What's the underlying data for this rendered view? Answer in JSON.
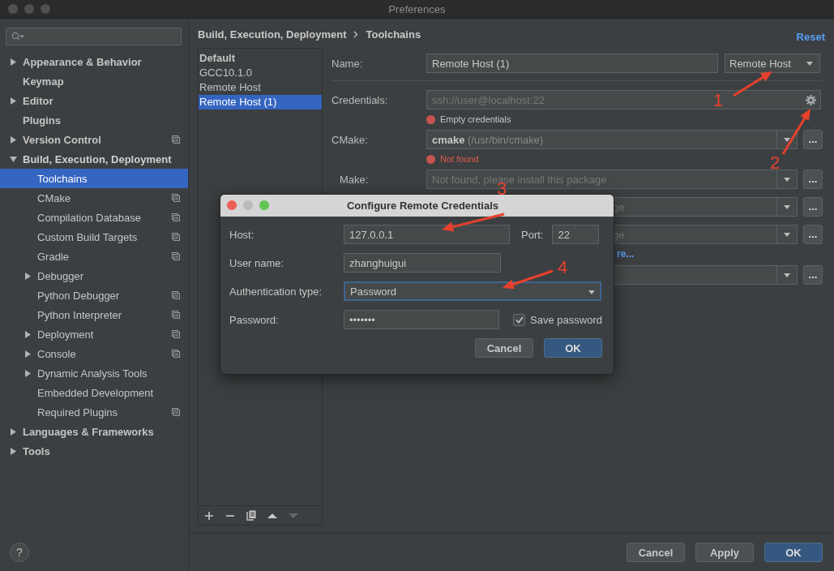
{
  "window": {
    "title": "Preferences"
  },
  "sidebar": {
    "items": [
      {
        "label": "Appearance & Behavior",
        "expandable": true,
        "expanded": false,
        "selected": false,
        "project_level": false
      },
      {
        "label": "Keymap",
        "expandable": false,
        "selected": false,
        "project_level": false
      },
      {
        "label": "Editor",
        "expandable": true,
        "expanded": false,
        "selected": false,
        "project_level": false
      },
      {
        "label": "Plugins",
        "expandable": false,
        "selected": false,
        "project_level": false
      },
      {
        "label": "Version Control",
        "expandable": true,
        "expanded": false,
        "selected": false,
        "project_level": true
      },
      {
        "label": "Build, Execution, Deployment",
        "expandable": true,
        "expanded": true,
        "selected": false,
        "project_level": false,
        "children": [
          {
            "label": "Toolchains",
            "expandable": false,
            "expanded": false,
            "selected": true,
            "project_level": false
          },
          {
            "label": "CMake",
            "expandable": false,
            "expanded": false,
            "selected": false,
            "project_level": true
          },
          {
            "label": "Compilation Database",
            "expandable": false,
            "expanded": false,
            "selected": false,
            "project_level": true
          },
          {
            "label": "Custom Build Targets",
            "expandable": false,
            "expanded": false,
            "selected": false,
            "project_level": true
          },
          {
            "label": "Gradle",
            "expandable": false,
            "expanded": false,
            "selected": false,
            "project_level": true
          },
          {
            "label": "Debugger",
            "expandable": true,
            "expanded": false,
            "selected": false,
            "project_level": false
          },
          {
            "label": "Python Debugger",
            "expandable": false,
            "expanded": false,
            "selected": false,
            "project_level": true
          },
          {
            "label": "Python Interpreter",
            "expandable": false,
            "expanded": false,
            "selected": false,
            "project_level": true
          },
          {
            "label": "Deployment",
            "expandable": true,
            "expanded": false,
            "selected": false,
            "project_level": true
          },
          {
            "label": "Console",
            "expandable": true,
            "expanded": false,
            "selected": false,
            "project_level": true
          },
          {
            "label": "Dynamic Analysis Tools",
            "expandable": true,
            "expanded": false,
            "selected": false,
            "project_level": false
          },
          {
            "label": "Embedded Development",
            "expandable": false,
            "expanded": false,
            "selected": false,
            "project_level": false
          },
          {
            "label": "Required Plugins",
            "expandable": false,
            "expanded": false,
            "selected": false,
            "project_level": true
          }
        ]
      },
      {
        "label": "Languages & Frameworks",
        "expandable": true,
        "expanded": false,
        "selected": false,
        "project_level": false
      },
      {
        "label": "Tools",
        "expandable": true,
        "expanded": false,
        "selected": false,
        "project_level": false
      }
    ]
  },
  "breadcrumb": [
    "Build, Execution, Deployment",
    "Toolchains"
  ],
  "reset": "Reset",
  "toolchains": [
    {
      "label": "Default",
      "selected": false,
      "default": true
    },
    {
      "label": "GCC10.1.0",
      "selected": false,
      "default": false
    },
    {
      "label": "Remote Host",
      "selected": false,
      "default": false
    },
    {
      "label": "Remote Host (1)",
      "selected": true,
      "default": false
    }
  ],
  "form": {
    "name_label": "Name:",
    "name_value": "Remote Host (1)",
    "type_value": "Remote Host",
    "credentials_label": "Credentials:",
    "credentials_placeholder": "ssh://user@localhost:22",
    "credentials_error": "Empty credentials",
    "cmake_label": "CMake:",
    "cmake_value": "cmake",
    "cmake_path": "(/usr/bin/cmake)",
    "cmake_error": "Not found",
    "make_label": "Make:",
    "make_placeholder": "Not found, please install this package",
    "hidden_rows": [
      "ge",
      "ge"
    ],
    "link": "re...",
    "more_button": "..."
  },
  "dialog": {
    "title": "Configure Remote Credentials",
    "host_label": "Host:",
    "host_value": "127.0.0.1",
    "port_label": "Port:",
    "port_value": "22",
    "user_label": "User name:",
    "user_value": "zhanghuigui",
    "auth_label": "Authentication type:",
    "auth_value": "Password",
    "password_label": "Password:",
    "password_value": "•••••••",
    "save_password": {
      "label": "Save password",
      "checked": true
    },
    "buttons": [
      {
        "label": "Cancel",
        "primary": false
      },
      {
        "label": "OK",
        "primary": true
      }
    ]
  },
  "annotations": [
    {
      "number": "1"
    },
    {
      "number": "2"
    },
    {
      "number": "3"
    },
    {
      "number": "4"
    }
  ],
  "footer": {
    "help": "?",
    "buttons": [
      {
        "label": "Cancel",
        "primary": false
      },
      {
        "label": "Apply",
        "primary": false
      },
      {
        "label": "OK",
        "primary": true
      }
    ]
  }
}
